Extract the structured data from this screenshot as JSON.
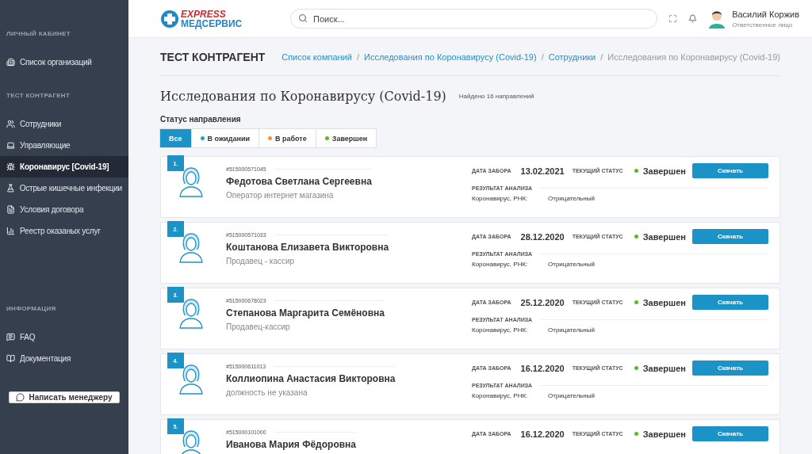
{
  "sidebar": {
    "sections": [
      {
        "title": "ЛИЧНЫЙ КАБИНЕТ",
        "items": [
          {
            "label": "Список организаций",
            "selected": false
          }
        ]
      },
      {
        "title": "ТЕСТ КОНТРАГЕНТ",
        "items": [
          {
            "label": "Сотрудники",
            "selected": false
          },
          {
            "label": "Управляющие",
            "selected": false
          },
          {
            "label": "Коронавирус [Covid-19]",
            "selected": true
          },
          {
            "label": "Острые кишечные инфекции",
            "selected": false
          },
          {
            "label": "Условия договора",
            "selected": false
          },
          {
            "label": "Реестр оказаных услуг",
            "selected": false
          }
        ]
      },
      {
        "title": "ИНФОРМАЦИЯ",
        "items": [
          {
            "label": "FAQ",
            "selected": false
          },
          {
            "label": "Документация",
            "selected": false
          }
        ]
      }
    ],
    "manager_button": "Написать менеджеру"
  },
  "header": {
    "logo_top": "EXPRESS",
    "logo_bottom": "МЕДСЕРВИС",
    "search": {
      "placeholder": "Поиск..."
    },
    "user": {
      "name": "Василий Коржив",
      "role": "Ответственное лицо"
    }
  },
  "page": {
    "title": "ТЕСТ КОНТРАГЕНТ",
    "breadcrumbs": [
      {
        "kind": "crumb",
        "label": "Список компаний",
        "link": true
      },
      {
        "kind": "separator",
        "label": "/"
      },
      {
        "kind": "crumb",
        "label": "Исследования по Коронавирусу (Covid-19)",
        "link": true
      },
      {
        "kind": "separator",
        "label": "/"
      },
      {
        "kind": "crumb",
        "label": "Сотрудники",
        "link": true
      },
      {
        "kind": "separator",
        "label": "/"
      },
      {
        "kind": "crumb",
        "label": "Исследования по Коронавирусу (Covid-19)",
        "link": false
      }
    ],
    "heading": "Исследования по Коронавирусу (Covid-19)",
    "found": "Найдено 16 направлений",
    "filter_label": "Статус направления",
    "filters": [
      {
        "label": "Все",
        "selected": true
      },
      {
        "label": "В ожидании",
        "selected": false,
        "color": "#1e9fd0"
      },
      {
        "label": "В работе",
        "selected": false,
        "color": "#f0953e"
      },
      {
        "label": "Завершен",
        "selected": false,
        "color": "#5cb82e"
      }
    ]
  },
  "cards": [
    {
      "number": "1.",
      "id": "#515000571045",
      "name": "Федотова Светлана Сергеевна",
      "position": "Оператор интернет магазина",
      "date_label": "ДАТА ЗАБОРА",
      "date": "13.02.2021",
      "status_label": "ТЕКУЩИЙ СТАТУС",
      "status": "Завершен",
      "color": "#5cb82e",
      "button": "Скачать",
      "result_label": "РЕЗУЛЬТАТ АНАЛИЗА",
      "test": "Коронавирус, РНК:",
      "result": "Отрицательный"
    },
    {
      "number": "2.",
      "id": "#515000571033",
      "name": "Коштанова Елизавета Викторовна",
      "position": "Продавец - кассир",
      "date_label": "ДАТА ЗАБОРА",
      "date": "28.12.2020",
      "status_label": "ТЕКУЩИЙ СТАТУС",
      "status": "Завершен",
      "color": "#5cb82e",
      "button": "Скачать",
      "result_label": "РЕЗУЛЬТАТ АНАЛИЗА",
      "test": "Коронавирус, РНК:",
      "result": "Отрицательный"
    },
    {
      "number": "3.",
      "id": "#515000678023",
      "name": "Степанова Маргарита Семёновна",
      "position": "Продавец-кассир",
      "date_label": "ДАТА ЗАБОРА",
      "date": "25.12.2020",
      "status_label": "ТЕКУЩИЙ СТАТУС",
      "status": "Завершен",
      "color": "#5cb82e",
      "button": "Скачать",
      "result_label": "РЕЗУЛЬТАТ АНАЛИЗА",
      "test": "Коронавирус, РНК:",
      "result": "Отрицательный"
    },
    {
      "number": "4.",
      "id": "#515000611013",
      "name": "Коллиопина Анастасия Викторовна",
      "position": "должность не указана",
      "date_label": "ДАТА ЗАБОРА",
      "date": "16.12.2020",
      "status_label": "ТЕКУЩИЙ СТАТУС",
      "status": "Завершен",
      "color": "#5cb82e",
      "button": "Скачать",
      "result_label": "РЕЗУЛЬТАТ АНАЛИЗА",
      "test": "Коронавирус, РНК:",
      "result": "Отрицательный"
    },
    {
      "number": "5.",
      "id": "#515000101000",
      "name": "Иванова Мария Фёдоровна",
      "date_label": "ДАТА ЗАБОРА",
      "date": "16.12.2020",
      "status_label": "ТЕКУЩИЙ СТАТУС",
      "status": "Завершен",
      "color": "#5cb82e",
      "button": "Скачать"
    }
  ]
}
